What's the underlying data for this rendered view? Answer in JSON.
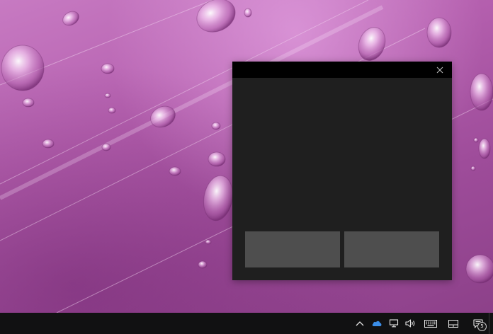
{
  "colors": {
    "titlebar": "#000000",
    "window_body": "#1f1f1f",
    "touchpad_button": "#4e4e4e",
    "taskbar": "#111112",
    "onedrive": "#3b8ee8",
    "wallpaper_base": "#b45fae"
  },
  "window": {
    "close_icon": "close-icon"
  },
  "taskbar": {
    "tray_icons": [
      "chevron-up-icon",
      "onedrive-icon",
      "network-icon",
      "volume-icon",
      "touch-keyboard-icon",
      "touchpad-icon",
      "action-center-icon"
    ],
    "notification_count": "5"
  }
}
